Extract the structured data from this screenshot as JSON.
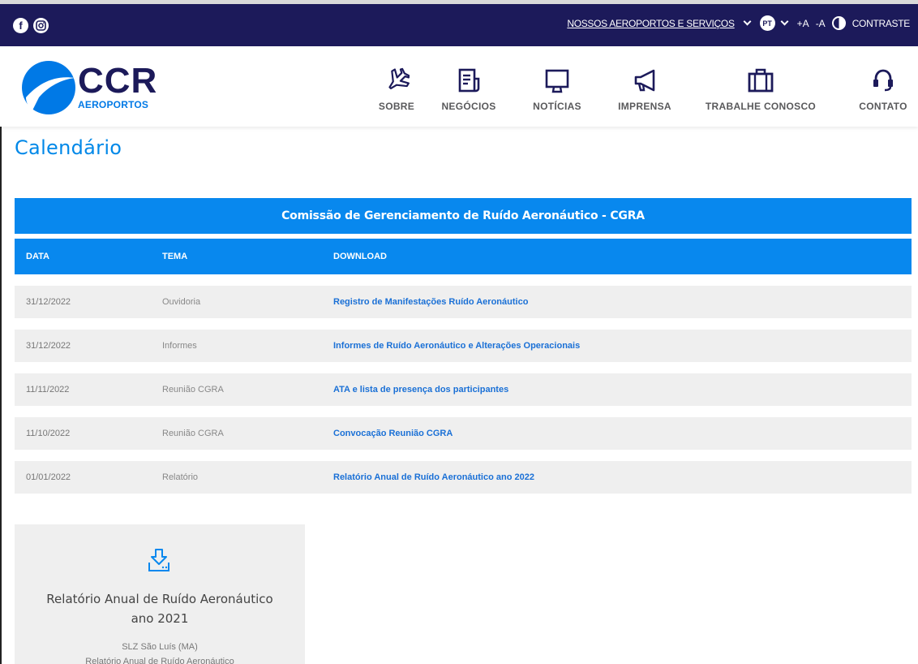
{
  "topbar": {
    "social": [
      "facebook-icon",
      "instagram-icon"
    ],
    "airports_link": "NOSSOS AEROPORTOS E SERVIÇOS",
    "lang": "PT",
    "font_plus": "+A",
    "font_minus": "-A",
    "contrast": "CONTRASTE"
  },
  "logo": {
    "name": "CCR",
    "sub": "AEROPORTOS"
  },
  "nav": [
    {
      "label": "SOBRE",
      "icon": "airplane-icon"
    },
    {
      "label": "NEGÓCIOS",
      "icon": "document-icon"
    },
    {
      "label": "NOTÍCIAS",
      "icon": "monitor-icon"
    },
    {
      "label": "IMPRENSA",
      "icon": "megaphone-icon"
    },
    {
      "label": "TRABALHE CONOSCO",
      "icon": "briefcase-icon"
    },
    {
      "label": "CONTATO",
      "icon": "headset-icon"
    }
  ],
  "page_title": "Calendário",
  "table": {
    "title": "Comissão de Gerenciamento de Ruído Aeronáutico - CGRA",
    "headers": [
      "DATA",
      "TEMA",
      "DOWNLOAD"
    ],
    "rows": [
      {
        "date": "31/12/2022",
        "tema": "Ouvidoria",
        "download": "Registro de Manifestações Ruído Aeronáutico"
      },
      {
        "date": "31/12/2022",
        "tema": "Informes",
        "download": "Informes de Ruído Aeronáutico e Alterações Operacionais"
      },
      {
        "date": "11/11/2022",
        "tema": "Reunião CGRA",
        "download": "ATA e lista de presença dos participantes"
      },
      {
        "date": "11/10/2022",
        "tema": "Reunião CGRA",
        "download": "Convocação Reunião CGRA"
      },
      {
        "date": "01/01/2022",
        "tema": "Relatório",
        "download": "Relatório Anual de Ruído Aeronáutico ano 2022"
      }
    ]
  },
  "card": {
    "title": "Relatório Anual de Ruído Aeronáutico ano 2021",
    "line1": "SLZ São Luís (MA)",
    "line2": "Relatório Anual de Ruído Aeronáutico"
  },
  "colors": {
    "navy": "#1c1a5a",
    "blue": "#0888ee",
    "link": "#1a70d6"
  }
}
